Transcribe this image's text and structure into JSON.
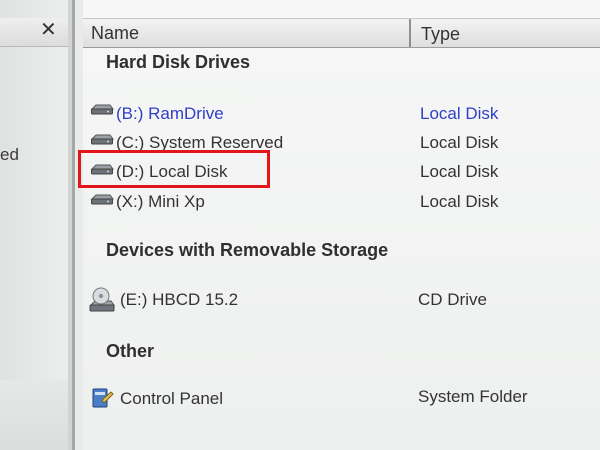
{
  "left_pane": {
    "close_glyph": "✕",
    "partial_text": "ed"
  },
  "columns": {
    "name": "Name",
    "type": "Type"
  },
  "groups": [
    {
      "title": "Hard Disk Drives",
      "items": [
        {
          "name": "(B:) RamDrive",
          "type": "Local Disk",
          "icon": "drive-icon",
          "highlight_color": "#2f3fc6"
        },
        {
          "name": "(C:) System Reserved",
          "type": "Local Disk",
          "icon": "drive-icon"
        },
        {
          "name": "(D:) Local Disk",
          "type": "Local Disk",
          "icon": "drive-icon",
          "selected_box_color": "#e1151a"
        },
        {
          "name": "(X:) Mini Xp",
          "type": "Local Disk",
          "icon": "drive-icon"
        }
      ]
    },
    {
      "title": "Devices with Removable Storage",
      "items": [
        {
          "name": "(E:) HBCD 15.2",
          "type": "CD Drive",
          "icon": "cd-drive-icon"
        }
      ]
    },
    {
      "title": "Other",
      "items": [
        {
          "name": "Control Panel",
          "type": "System Folder",
          "icon": "control-panel-icon"
        }
      ]
    }
  ]
}
